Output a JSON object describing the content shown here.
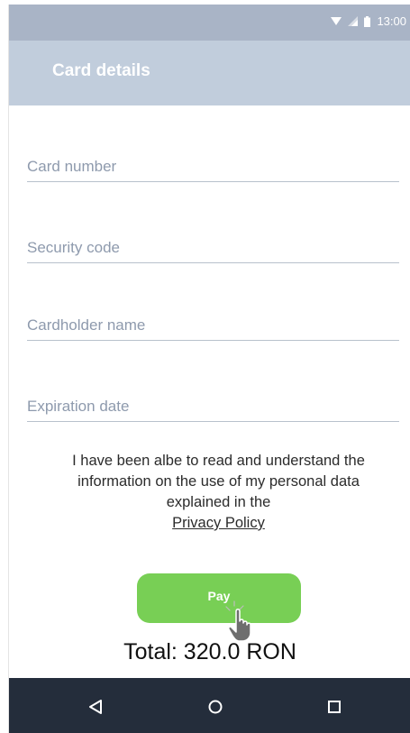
{
  "status_bar": {
    "time": "13:00",
    "icons": [
      "wifi-icon",
      "signal-icon",
      "battery-icon"
    ]
  },
  "app_bar": {
    "title": "Card details"
  },
  "form": {
    "card_number_placeholder": "Card number",
    "security_code_placeholder": "Security code",
    "cardholder_name_placeholder": "Cardholder name",
    "expiration_date_placeholder": "Expiration date"
  },
  "consent": {
    "text": "I have been albe to read and understand the information on the use of my personal data explained in the",
    "link_label": "Privacy Policy"
  },
  "pay_button_label": "Pay",
  "total": "Total: 320.0 RON",
  "nav_bar": {
    "icons": [
      "back-icon",
      "home-icon",
      "recents-icon"
    ]
  },
  "colors": {
    "status_bar": "#a9b4c6",
    "app_bar": "#c1cddc",
    "pay_button": "#78cf55",
    "nav_bar": "#242d3b"
  }
}
